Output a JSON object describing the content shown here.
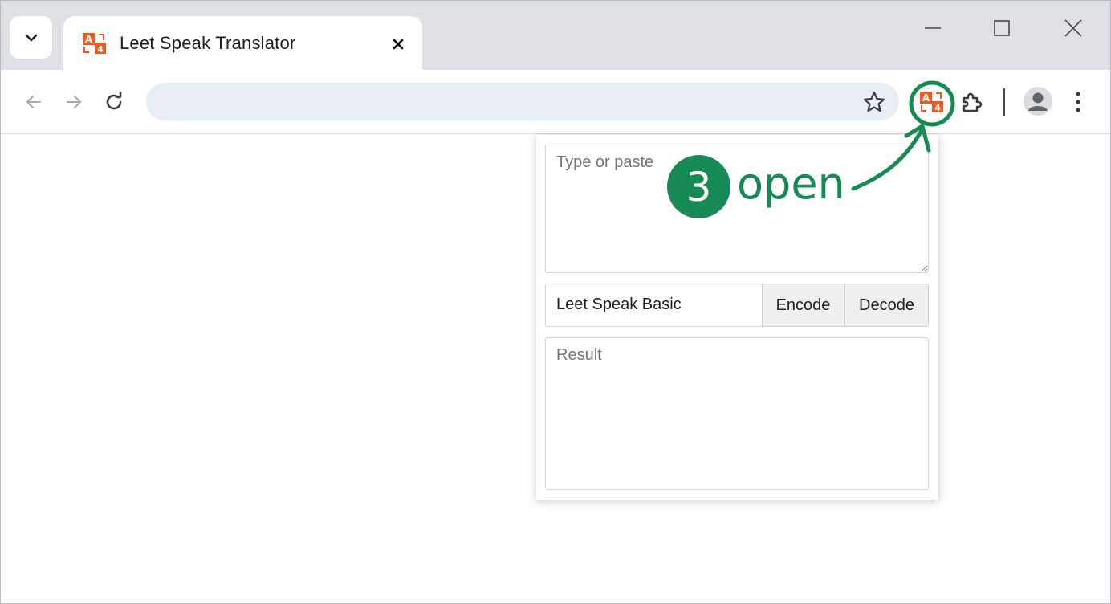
{
  "tab": {
    "title": "Leet Speak Translator",
    "favicon": "translate-a-4-icon"
  },
  "window_controls": [
    "minimize",
    "maximize",
    "close"
  ],
  "toolbar": {
    "address_value": "",
    "icons": [
      "back-icon",
      "forward-icon",
      "reload-icon",
      "bookmark-star-icon",
      "leet-extension-icon",
      "extensions-puzzle-icon",
      "profile-avatar-icon",
      "menu-kebab-icon"
    ]
  },
  "popup": {
    "input_placeholder": "Type or paste",
    "mode_selected": "Leet Speak Basic",
    "encode_label": "Encode",
    "decode_label": "Decode",
    "result_placeholder": "Result"
  },
  "annotation": {
    "step_number": "3",
    "step_label": "open",
    "color": "#168a53"
  },
  "colors": {
    "brand_orange": "#f05a22",
    "tabstrip": "#dfe1e6",
    "omnibox": "#e9edf6"
  }
}
